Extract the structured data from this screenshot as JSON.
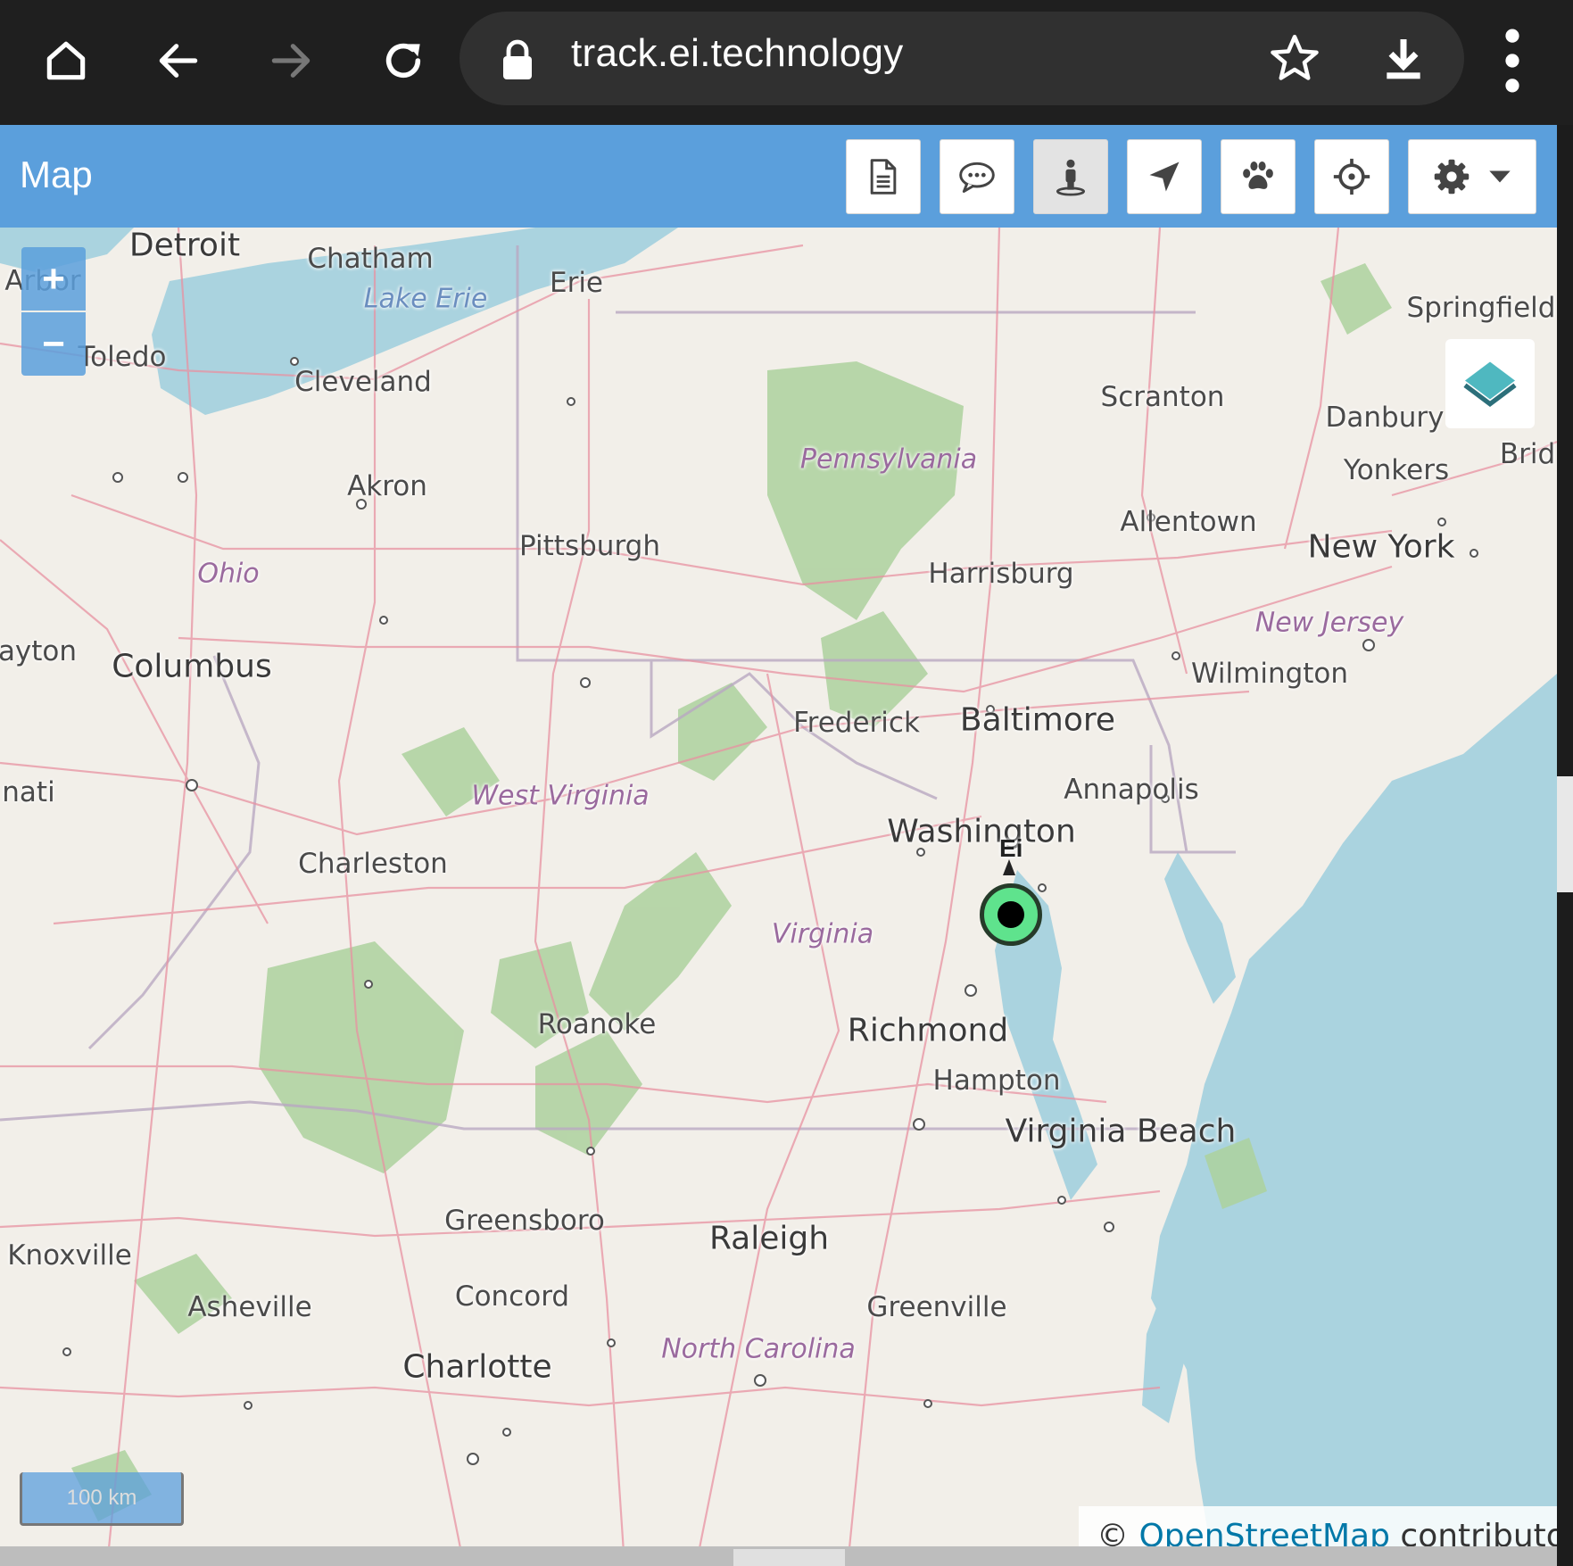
{
  "browser": {
    "url": "track.ei.technology"
  },
  "app": {
    "title": "Map",
    "toolbar": [
      {
        "name": "report-button",
        "icon": "document-icon"
      },
      {
        "name": "chat-button",
        "icon": "chat-bubble-icon"
      },
      {
        "name": "person-button",
        "icon": "person-icon",
        "active": true
      },
      {
        "name": "navigate-button",
        "icon": "navigation-arrow-icon"
      },
      {
        "name": "pet-button",
        "icon": "paw-icon"
      },
      {
        "name": "locate-button",
        "icon": "crosshair-icon"
      },
      {
        "name": "settings-dropdown",
        "icon": "gear-icon"
      }
    ]
  },
  "map": {
    "zoom_in": "+",
    "zoom_out": "−",
    "marker_label": "Ei",
    "scale": "100 km",
    "attribution_prefix": "© ",
    "attribution_link": "OpenStreetMap",
    "attribution_suffix": " contributors.",
    "places": {
      "detroit": "Detroit",
      "chatham": "Chatham",
      "arbor": "Arbor",
      "lake_erie": "Lake Erie",
      "erie": "Erie",
      "toledo": "Toledo",
      "cleveland": "Cleveland",
      "akron": "Akron",
      "springfield": "Springfield",
      "scranton": "Scranton",
      "danbury": "Danbury",
      "brid": "Brid",
      "yonkers": "Yonkers",
      "pennsylvania": "Pennsylvania",
      "allentown": "Allentown",
      "new_york": "New York",
      "pittsburgh": "Pittsburgh",
      "harrisburg": "Harrisburg",
      "ohio": "Ohio",
      "new_jersey": "New Jersey",
      "dayton": "ayton",
      "columbus": "Columbus",
      "wilmington": "Wilmington",
      "frederick": "Frederick",
      "baltimore": "Baltimore",
      "annapolis": "Annapolis",
      "cincinnati": "nati",
      "west_virginia": "West Virginia",
      "washington": "Washington",
      "charleston": "Charleston",
      "virginia": "Virginia",
      "roanoke": "Roanoke",
      "richmond": "Richmond",
      "hampton": "Hampton",
      "virginia_beach": "Virginia Beach",
      "greensboro": "Greensboro",
      "raleigh": "Raleigh",
      "knoxville": "Knoxville",
      "asheville": "Asheville",
      "concord": "Concord",
      "greenville": "Greenville",
      "north_carolina": "North Carolina",
      "charlotte": "Charlotte"
    }
  },
  "colors": {
    "header": "#5b9fdc",
    "land": "#f2efe9",
    "water": "#aad3df",
    "forest": "#add19e",
    "marker_fill": "#5fe38d"
  }
}
